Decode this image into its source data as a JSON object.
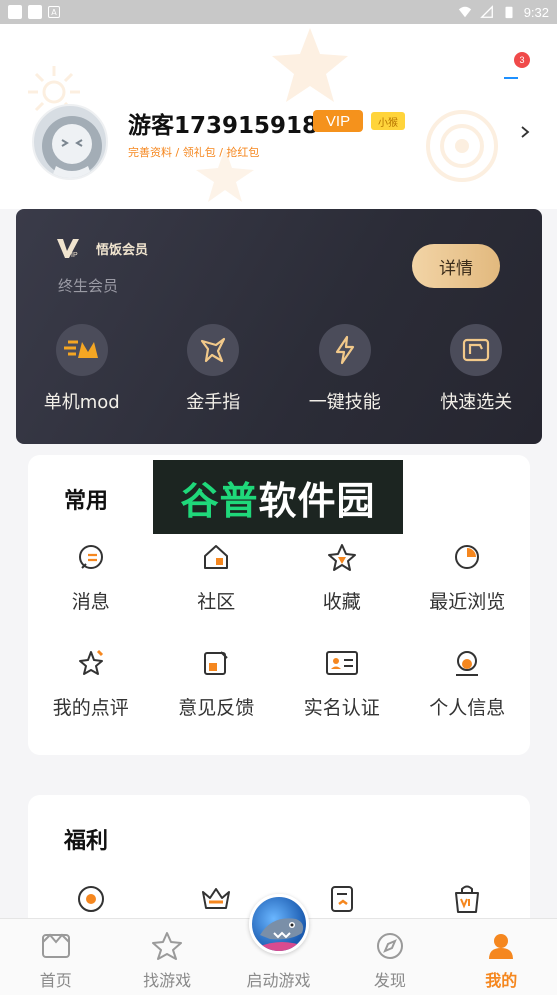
{
  "status_bar": {
    "time": "9:32"
  },
  "header": {
    "username": "游客173915918",
    "vip_label": "VIP",
    "small_label": "小猴",
    "subline": "完善资料 / 领礼包 / 抢红包",
    "notification_count": "3"
  },
  "vip_card": {
    "brand": "悟饭会员",
    "term": "终生会员",
    "detail_button": "详情",
    "features": [
      {
        "label": "单机mod",
        "icon": "mod-icon"
      },
      {
        "label": "金手指",
        "icon": "golden-finger-icon"
      },
      {
        "label": "一键技能",
        "icon": "lightning-icon"
      },
      {
        "label": "快速选关",
        "icon": "level-select-icon"
      }
    ]
  },
  "watermark": {
    "part1": "谷普",
    "part2": "软件园"
  },
  "common": {
    "title": "常用",
    "items": [
      {
        "label": "消息",
        "icon": "message-icon"
      },
      {
        "label": "社区",
        "icon": "community-icon"
      },
      {
        "label": "收藏",
        "icon": "favorite-icon"
      },
      {
        "label": "最近浏览",
        "icon": "recent-icon"
      },
      {
        "label": "我的点评",
        "icon": "review-icon"
      },
      {
        "label": "意见反馈",
        "icon": "feedback-icon"
      },
      {
        "label": "实名认证",
        "icon": "id-card-icon"
      },
      {
        "label": "个人信息",
        "icon": "profile-icon"
      }
    ]
  },
  "welfare": {
    "title": "福利",
    "items": [
      {
        "icon": "record-icon"
      },
      {
        "icon": "crown-icon"
      },
      {
        "icon": "task-icon"
      },
      {
        "icon": "vip-bag-icon"
      }
    ]
  },
  "bottom_nav": {
    "items": [
      {
        "label": "首页",
        "icon": "home-icon"
      },
      {
        "label": "找游戏",
        "icon": "star-icon"
      },
      {
        "label": "启动游戏",
        "icon": "game-icon"
      },
      {
        "label": "发现",
        "icon": "compass-icon"
      },
      {
        "label": "我的",
        "icon": "user-icon"
      }
    ]
  },
  "colors": {
    "accent": "#f5871f",
    "vip_card": "#2f303c",
    "gold": "#e8c48d"
  }
}
